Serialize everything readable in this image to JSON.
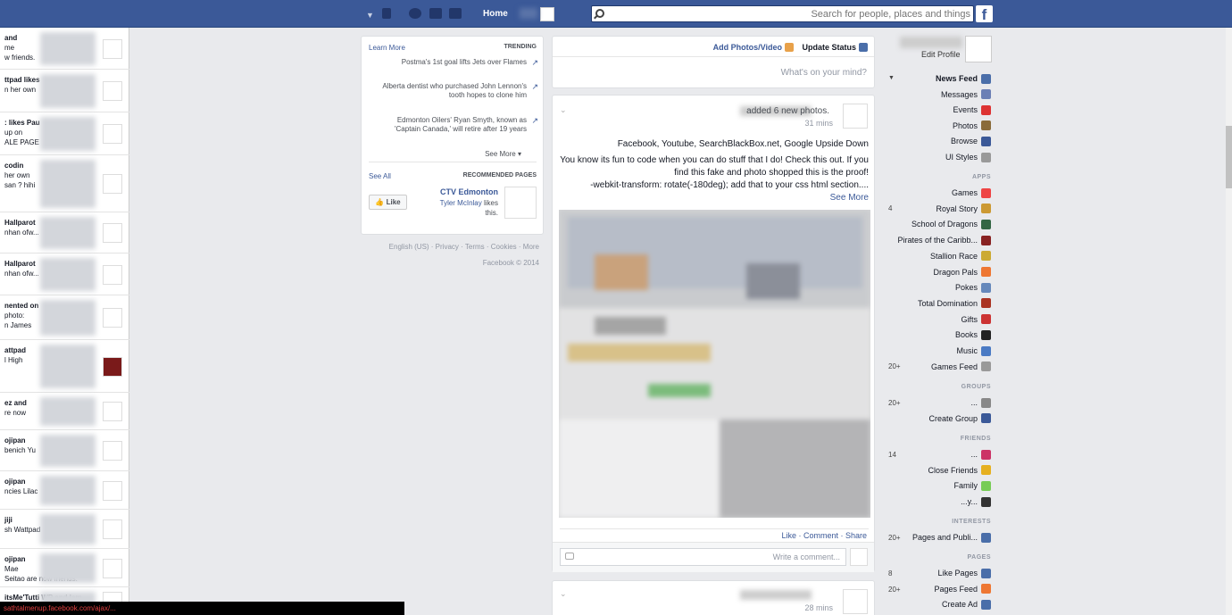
{
  "topbar": {
    "search_placeholder": "Search for people, places and things",
    "home": "Home",
    "logo": "f"
  },
  "left_nav": {
    "edit_profile": "Edit Profile",
    "items": [
      {
        "label": "News Feed",
        "color": "#4a6ea9"
      },
      {
        "label": "Messages",
        "color": "#6b7fb5"
      },
      {
        "label": "Events",
        "color": "#d33"
      },
      {
        "label": "Photos",
        "color": "#8a6b3a"
      },
      {
        "label": "Browse",
        "color": "#3b5998"
      },
      {
        "label": "UI Styles",
        "color": "#999"
      }
    ],
    "apps_header": "APPS",
    "apps": [
      {
        "label": "Games",
        "color": "#e44"
      },
      {
        "label": "Royal Story",
        "color": "#c93"
      },
      {
        "label": "School of Dragons",
        "color": "#364"
      },
      {
        "label": "Pirates of the Caribb...",
        "color": "#822"
      },
      {
        "label": "Stallion Race",
        "color": "#ca3"
      },
      {
        "label": "Dragon Pals",
        "color": "#e73"
      },
      {
        "label": "Pokes",
        "color": "#68b"
      },
      {
        "label": "Total Domination",
        "color": "#a32"
      },
      {
        "label": "Gifts",
        "color": "#c33"
      },
      {
        "label": "Books",
        "color": "#222"
      },
      {
        "label": "Music",
        "color": "#4a7ac4"
      },
      {
        "label": "Games Feed",
        "color": "#999"
      }
    ],
    "apps_counts": {
      "royal_story": "4",
      "games_feed": "20+"
    },
    "groups_header": "GROUPS",
    "groups": [
      {
        "label": "...",
        "color": "#888"
      },
      {
        "label": "Create Group",
        "color": "#3b5998"
      }
    ],
    "groups_count": "20+",
    "friends_header": "FRIENDS",
    "friends": [
      {
        "label": "...",
        "color": "#c36"
      },
      {
        "label": "Close Friends",
        "color": "#e6b020"
      },
      {
        "label": "Family",
        "color": "#7c5"
      },
      {
        "label": "...y...",
        "color": "#333"
      }
    ],
    "friends_count": "14",
    "interests_header": "INTERESTS",
    "interests": [
      {
        "label": "Pages and Publi...",
        "color": "#4a6ea9"
      }
    ],
    "interests_count": "20+",
    "pages_header": "PAGES",
    "pages": [
      {
        "label": "Like Pages",
        "color": "#4a6ea9"
      },
      {
        "label": "Pages Feed",
        "color": "#e73"
      },
      {
        "label": "Create Ad",
        "color": "#4a6ea9"
      }
    ],
    "pages_counts": {
      "like_pages": "8",
      "pages_feed": "20+"
    }
  },
  "composer": {
    "update_status": "Update Status",
    "add_photos": "Add Photos/Video",
    "placeholder": "What's on your mind?"
  },
  "post": {
    "action": "added 6 new photos.",
    "time": "31 mins",
    "line1": "Facebook, Youtube, SearchBlackBox.net, Google Upside Down",
    "line2": "You know its fun to code when you can do stuff that I do! Check this out. If you find this fake and photo shopped this is the proof!",
    "line3": "-webkit-transform: rotate(-180deg); add that to your css html section....",
    "see_more": "See More",
    "like": "Like",
    "comment": "Comment",
    "share": "Share",
    "comment_placeholder": "Write a comment..."
  },
  "post2": {
    "time": "28 mins"
  },
  "trending": {
    "header": "TRENDING",
    "learn_more": "Learn More",
    "items": [
      "Postma's 1st goal lifts Jets over Flames",
      "Alberta dentist who purchased John Lennon's tooth hopes to clone him",
      "Edmonton Oilers' Ryan Smyth, known as 'Captain Canada,' will retire after 19 years"
    ],
    "see_more": "See More",
    "rec_header": "RECOMMENDED PAGES",
    "see_all": "See All",
    "page_name": "CTV Edmonton",
    "page_likes_name": "Tyler McInlay",
    "page_likes_text": "likes this.",
    "like_btn": "Like"
  },
  "footer": {
    "links": "English (US) · Privacy · Terms · Cookies · More",
    "copyright": "Facebook © 2014"
  },
  "rail": {
    "rows": [
      {
        "a": "and",
        "b": "me",
        "c": "w friends."
      },
      {
        "a": "ttpad likes",
        "b": "n her own"
      },
      {
        "a": ": likes Pau",
        "b": "up on",
        "c": "ALE PAGE"
      },
      {
        "a": "codin",
        "b": "her own",
        "c": "san ? hihi"
      },
      {
        "a": "Hallparot",
        "b": "nhan ofw..."
      },
      {
        "a": "Hallparot",
        "b": "nhan ofw..."
      },
      {
        "a": "nented on",
        "b": "photo:",
        "c": "n James"
      },
      {
        "a": "attpad",
        "b": "l High"
      },
      {
        "a": "ez and",
        "b": "re now"
      },
      {
        "a": "ojipan",
        "b": "benich Yu"
      },
      {
        "a": "ojipan",
        "b": "ncies Lilac"
      },
      {
        "a": "jiji",
        "b": "sh Wattpad"
      },
      {
        "a": "ojipan",
        "b": "Mae",
        "c": "Seitao are now friends."
      },
      {
        "a": "itsMe'Tutti WP and Iam"
      }
    ]
  },
  "bottom_bar": "sathtalmenup.facebook.com/ajax/..."
}
